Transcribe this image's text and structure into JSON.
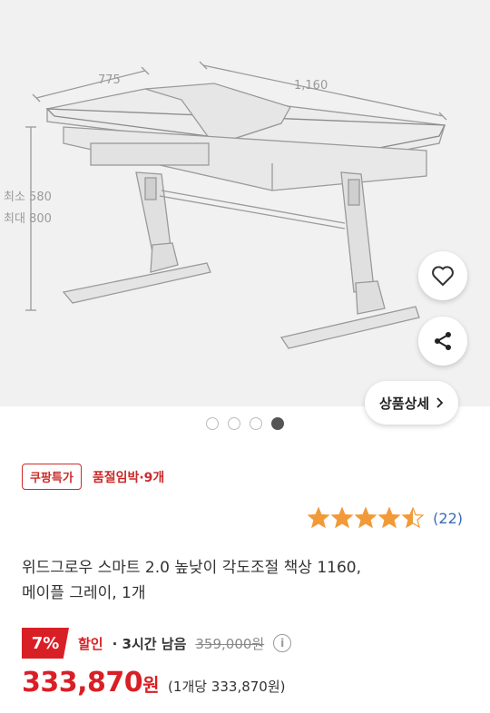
{
  "product_image": {
    "dim_depth": "775",
    "dim_width": "1,160",
    "dim_min_height": "최소 580",
    "dim_max_height": "최대 800"
  },
  "actions": {
    "heart_icon": "heart-icon",
    "share_icon": "share-icon",
    "detail_label": "상품상세"
  },
  "carousel": {
    "total": 4,
    "active_index": 3
  },
  "badge": {
    "label": "쿠팡특가",
    "stock_text": "품절임박·9개"
  },
  "rating": {
    "stars": 4.5,
    "count": "(22)",
    "star_color": "#f29a38"
  },
  "product": {
    "title_line1": "위드그로우 스마트 2.0 높낮이 각도조절 책상 1160,",
    "title_line2": "메이플 그레이, 1개"
  },
  "pricing": {
    "discount_pct": "7%",
    "sale_label": "할인",
    "time_remaining": "· 3시간 남음",
    "original_price": "359,000원",
    "price_number": "333,870",
    "price_unit": "원",
    "unit_price": "(1개당 333,870원)",
    "accent_color": "#d91f26"
  }
}
